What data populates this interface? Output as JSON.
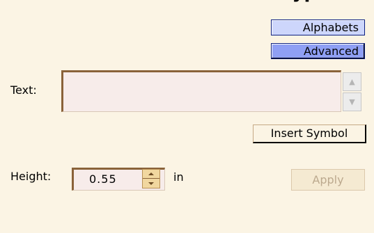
{
  "header": {
    "title_fragment": "ypo"
  },
  "tabs": {
    "alphabets_label": "Alphabets",
    "advanced_label": "Advanced"
  },
  "text_input": {
    "label": "Text:",
    "value": ""
  },
  "insert_symbol_label": "Insert Symbol",
  "height": {
    "label": "Height:",
    "value": "0.55",
    "unit": "in"
  },
  "apply_label": "Apply",
  "icons": {
    "scroll_up": "triangle-up",
    "scroll_down": "triangle-down",
    "stepper": "spin-arrows"
  }
}
